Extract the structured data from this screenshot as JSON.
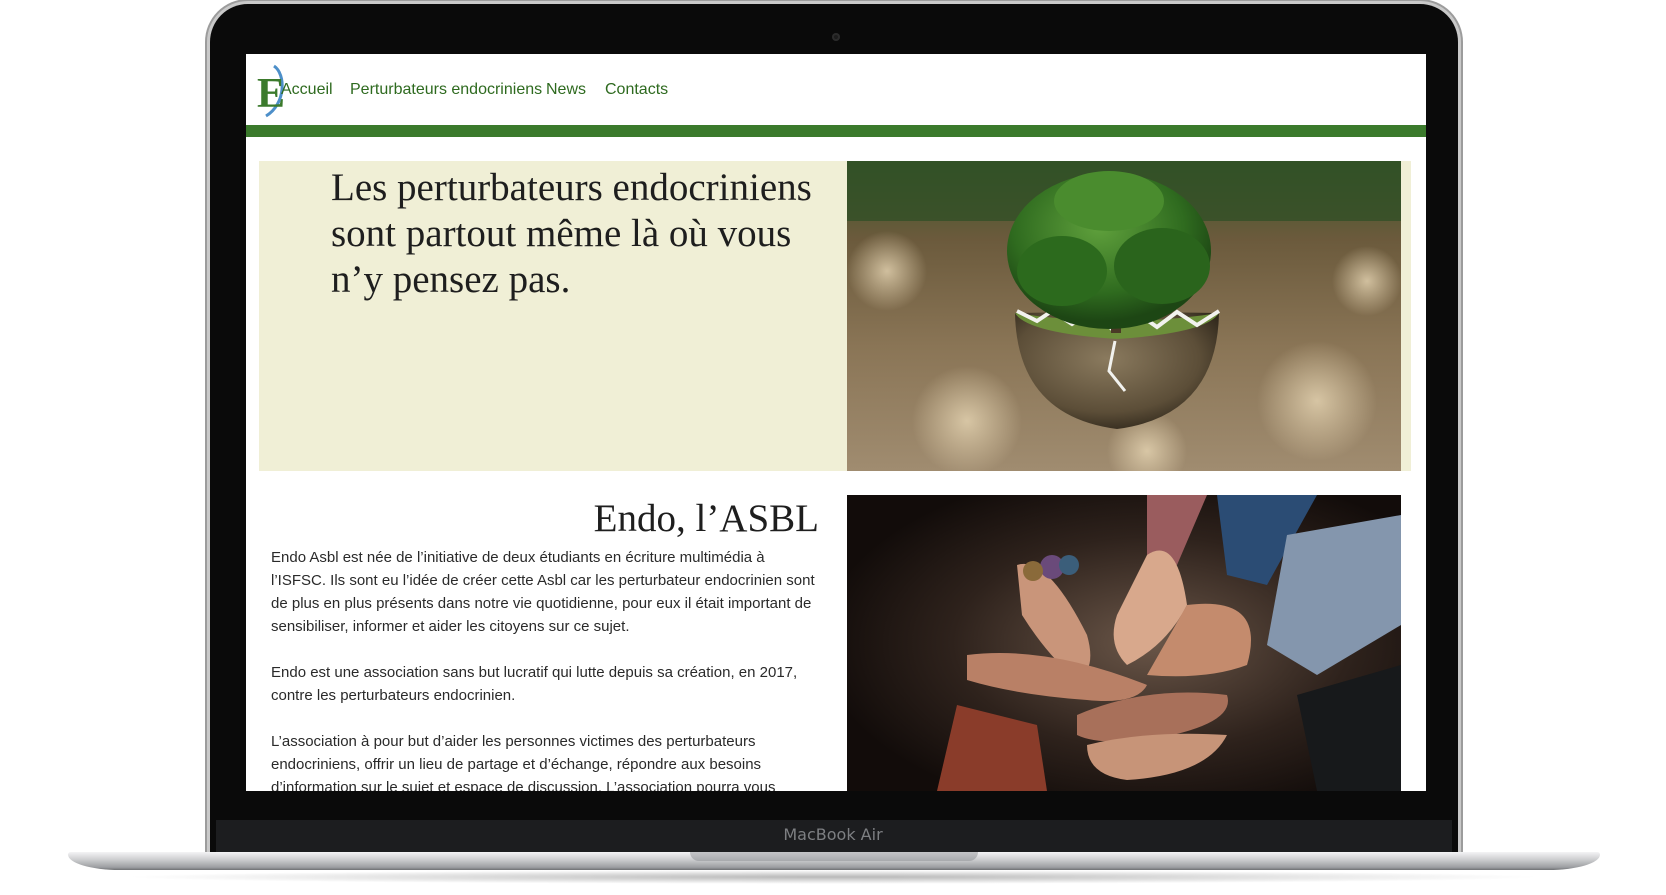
{
  "device": {
    "model_label": "MacBook Air"
  },
  "site": {
    "logo_letter": "E",
    "nav": [
      {
        "label": "Accueil"
      },
      {
        "label": "Perturbateurs endocriniens"
      },
      {
        "label": "News"
      },
      {
        "label": "Contacts"
      }
    ]
  },
  "hero": {
    "heading": "Les perturbateurs endocriniens sont partout même là où vous n’y pensez pas."
  },
  "about": {
    "title": "Endo, l’ASBL",
    "paragraphs": [
      "Endo Asbl est née de l’initiative de deux étudiants en écriture multimédia à l’ISFSC. Ils sont eu l’idée de créer cette Asbl car les perturbateur endocrinien sont de plus en plus présents dans notre vie quotidienne, pour eux il était important de sensibiliser, informer et aider les citoyens sur ce sujet.",
      "Endo est une association sans but lucratif qui lutte depuis sa création, en 2017, contre les perturbateurs endocrinien.",
      "L’association à pour but d’aider les personnes victimes des perturbateurs endocriniens, offrir un lieu de partage et d’échange, répondre aux besoins d’information sur le sujet et espace de discussion. L’association pourra vous"
    ]
  },
  "colors": {
    "accent_green": "#3b7a2c",
    "nav_text": "#2e6a1f",
    "hero_background": "#f0efd6",
    "laptop_bezel": "#0a0a0a"
  }
}
